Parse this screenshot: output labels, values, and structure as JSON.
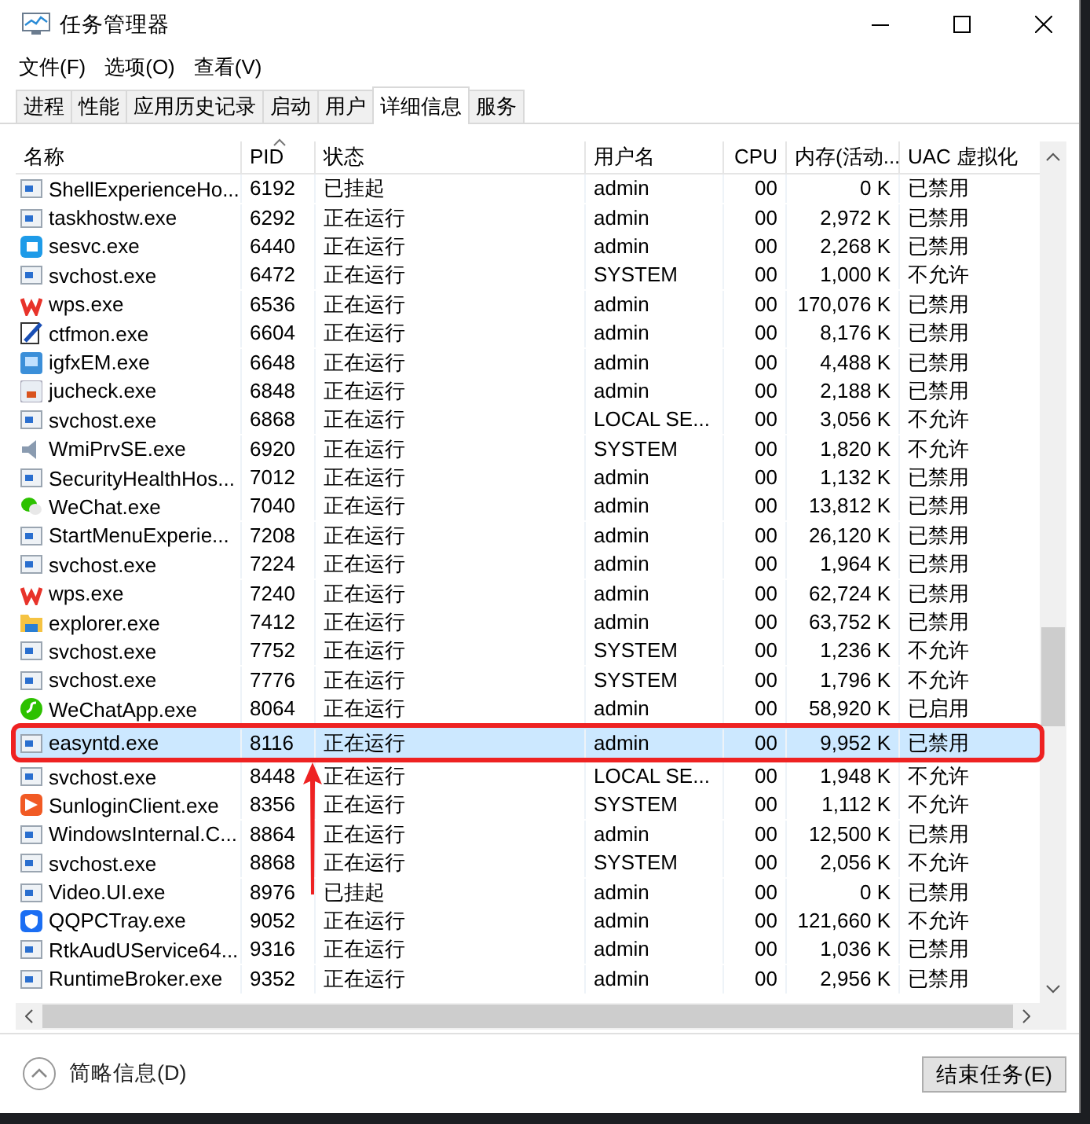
{
  "window": {
    "title": "任务管理器"
  },
  "menu": [
    "文件(F)",
    "选项(O)",
    "查看(V)"
  ],
  "tabs": [
    {
      "label": "进程",
      "selected": false
    },
    {
      "label": "性能",
      "selected": false
    },
    {
      "label": "应用历史记录",
      "selected": false
    },
    {
      "label": "启动",
      "selected": false
    },
    {
      "label": "用户",
      "selected": false
    },
    {
      "label": "详细信息",
      "selected": true
    },
    {
      "label": "服务",
      "selected": false
    }
  ],
  "columns": [
    "名称",
    "PID",
    "状态",
    "用户名",
    "CPU",
    "内存(活动...",
    "UAC 虚拟化"
  ],
  "rows": [
    {
      "kind": "window",
      "name": "ShellExperienceHo...",
      "pid": "6192",
      "status": "已挂起",
      "user": "admin",
      "cpu": "00",
      "memory": "0 K",
      "uac": "已禁用",
      "selected": false
    },
    {
      "kind": "window",
      "name": "taskhostw.exe",
      "pid": "6292",
      "status": "正在运行",
      "user": "admin",
      "cpu": "00",
      "memory": "2,972 K",
      "uac": "已禁用",
      "selected": false
    },
    {
      "kind": "browser",
      "name": "sesvc.exe",
      "pid": "6440",
      "status": "正在运行",
      "user": "admin",
      "cpu": "00",
      "memory": "2,268 K",
      "uac": "已禁用",
      "selected": false
    },
    {
      "kind": "window",
      "name": "svchost.exe",
      "pid": "6472",
      "status": "正在运行",
      "user": "SYSTEM",
      "cpu": "00",
      "memory": "1,000 K",
      "uac": "不允许",
      "selected": false
    },
    {
      "kind": "wps",
      "name": "wps.exe",
      "pid": "6536",
      "status": "正在运行",
      "user": "admin",
      "cpu": "00",
      "memory": "170,076 K",
      "uac": "已禁用",
      "selected": false
    },
    {
      "kind": "pen",
      "name": "ctfmon.exe",
      "pid": "6604",
      "status": "正在运行",
      "user": "admin",
      "cpu": "00",
      "memory": "8,176 K",
      "uac": "已禁用",
      "selected": false
    },
    {
      "kind": "monitor",
      "name": "igfxEM.exe",
      "pid": "6648",
      "status": "正在运行",
      "user": "admin",
      "cpu": "00",
      "memory": "4,488 K",
      "uac": "已禁用",
      "selected": false
    },
    {
      "kind": "cup",
      "name": "jucheck.exe",
      "pid": "6848",
      "status": "正在运行",
      "user": "admin",
      "cpu": "00",
      "memory": "2,188 K",
      "uac": "已禁用",
      "selected": false
    },
    {
      "kind": "window",
      "name": "svchost.exe",
      "pid": "6868",
      "status": "正在运行",
      "user": "LOCAL SE...",
      "cpu": "00",
      "memory": "3,056 K",
      "uac": "不允许",
      "selected": false
    },
    {
      "kind": "speaker",
      "name": "WmiPrvSE.exe",
      "pid": "6920",
      "status": "正在运行",
      "user": "SYSTEM",
      "cpu": "00",
      "memory": "1,820 K",
      "uac": "不允许",
      "selected": false
    },
    {
      "kind": "window",
      "name": "SecurityHealthHos...",
      "pid": "7012",
      "status": "正在运行",
      "user": "admin",
      "cpu": "00",
      "memory": "1,132 K",
      "uac": "已禁用",
      "selected": false
    },
    {
      "kind": "chat",
      "name": "WeChat.exe",
      "pid": "7040",
      "status": "正在运行",
      "user": "admin",
      "cpu": "00",
      "memory": "13,812 K",
      "uac": "已禁用",
      "selected": false
    },
    {
      "kind": "window",
      "name": "StartMenuExperie...",
      "pid": "7208",
      "status": "正在运行",
      "user": "admin",
      "cpu": "00",
      "memory": "26,120 K",
      "uac": "已禁用",
      "selected": false
    },
    {
      "kind": "window",
      "name": "svchost.exe",
      "pid": "7224",
      "status": "正在运行",
      "user": "admin",
      "cpu": "00",
      "memory": "1,964 K",
      "uac": "已禁用",
      "selected": false
    },
    {
      "kind": "wps",
      "name": "wps.exe",
      "pid": "7240",
      "status": "正在运行",
      "user": "admin",
      "cpu": "00",
      "memory": "62,724 K",
      "uac": "已禁用",
      "selected": false
    },
    {
      "kind": "folder",
      "name": "explorer.exe",
      "pid": "7412",
      "status": "正在运行",
      "user": "admin",
      "cpu": "00",
      "memory": "63,752 K",
      "uac": "已禁用",
      "selected": false
    },
    {
      "kind": "window",
      "name": "svchost.exe",
      "pid": "7752",
      "status": "正在运行",
      "user": "SYSTEM",
      "cpu": "00",
      "memory": "1,236 K",
      "uac": "不允许",
      "selected": false
    },
    {
      "kind": "window",
      "name": "svchost.exe",
      "pid": "7776",
      "status": "正在运行",
      "user": "SYSTEM",
      "cpu": "00",
      "memory": "1,796 K",
      "uac": "不允许",
      "selected": false
    },
    {
      "kind": "link",
      "name": "WeChatApp.exe",
      "pid": "8064",
      "status": "正在运行",
      "user": "admin",
      "cpu": "00",
      "memory": "58,920 K",
      "uac": "已启用",
      "selected": false
    },
    {
      "kind": "window",
      "name": "easyntd.exe",
      "pid": "8116",
      "status": "正在运行",
      "user": "admin",
      "cpu": "00",
      "memory": "9,952 K",
      "uac": "已禁用",
      "selected": true,
      "annotated": true
    },
    {
      "kind": "window",
      "name": "svchost.exe",
      "pid": "8448",
      "status": "正在运行",
      "user": "LOCAL SE...",
      "cpu": "00",
      "memory": "1,948 K",
      "uac": "不允许",
      "selected": false
    },
    {
      "kind": "remote",
      "name": "SunloginClient.exe",
      "pid": "8356",
      "status": "正在运行",
      "user": "SYSTEM",
      "cpu": "00",
      "memory": "1,112 K",
      "uac": "不允许",
      "selected": false
    },
    {
      "kind": "window",
      "name": "WindowsInternal.C...",
      "pid": "8864",
      "status": "正在运行",
      "user": "admin",
      "cpu": "00",
      "memory": "12,500 K",
      "uac": "已禁用",
      "selected": false
    },
    {
      "kind": "window",
      "name": "svchost.exe",
      "pid": "8868",
      "status": "正在运行",
      "user": "SYSTEM",
      "cpu": "00",
      "memory": "2,056 K",
      "uac": "不允许",
      "selected": false
    },
    {
      "kind": "window",
      "name": "Video.UI.exe",
      "pid": "8976",
      "status": "已挂起",
      "user": "admin",
      "cpu": "00",
      "memory": "0 K",
      "uac": "已禁用",
      "selected": false
    },
    {
      "kind": "shield",
      "name": "QQPCTray.exe",
      "pid": "9052",
      "status": "正在运行",
      "user": "admin",
      "cpu": "00",
      "memory": "121,660 K",
      "uac": "不允许",
      "selected": false
    },
    {
      "kind": "window",
      "name": "RtkAudUService64...",
      "pid": "9316",
      "status": "正在运行",
      "user": "admin",
      "cpu": "00",
      "memory": "1,036 K",
      "uac": "已禁用",
      "selected": false
    },
    {
      "kind": "window",
      "name": "RuntimeBroker.exe",
      "pid": "9352",
      "status": "正在运行",
      "user": "admin",
      "cpu": "00",
      "memory": "2,956 K",
      "uac": "已禁用",
      "selected": false
    }
  ],
  "footer": {
    "details_toggle": "简略信息(D)",
    "end_task_button": "结束任务(E)"
  }
}
